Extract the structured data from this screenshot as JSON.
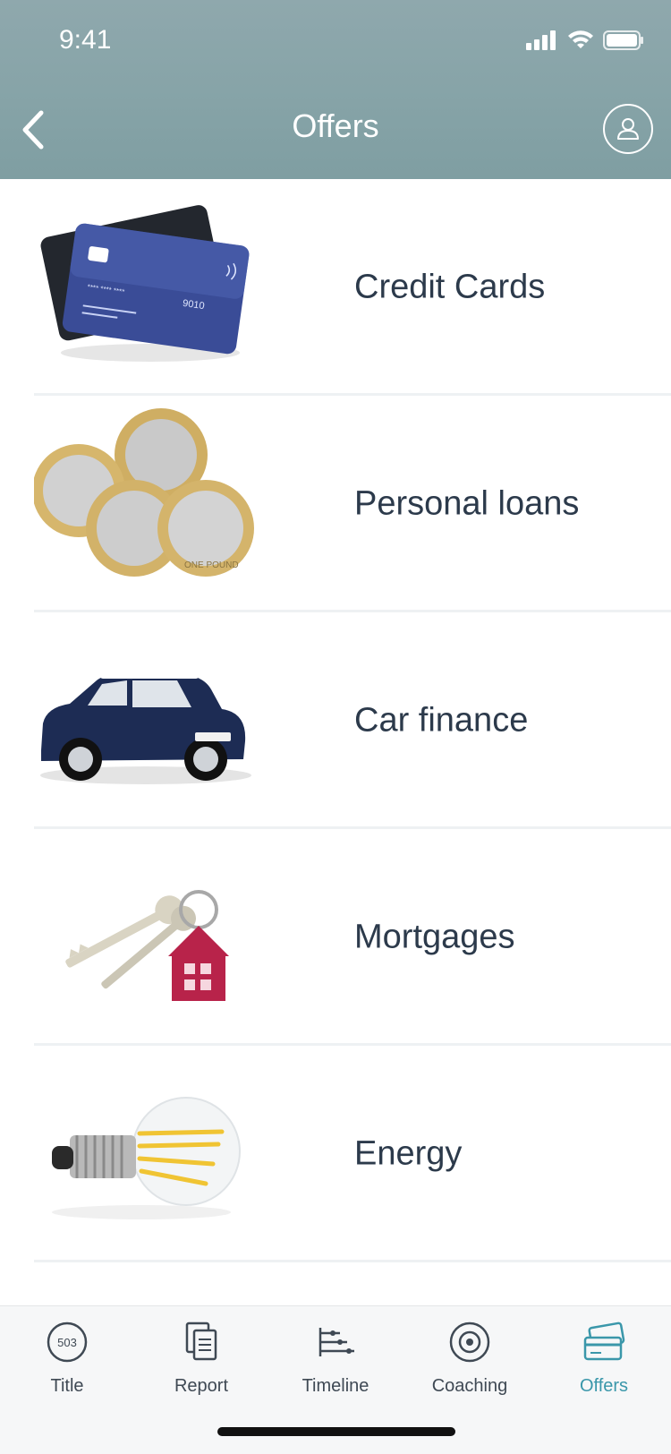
{
  "status_bar": {
    "time": "9:41"
  },
  "header": {
    "title": "Offers",
    "back_icon": "chevron-left-icon",
    "profile_icon": "user-icon"
  },
  "offers": [
    {
      "label": "Credit Cards",
      "image": "credit-cards-image"
    },
    {
      "label": "Personal loans",
      "image": "coins-image"
    },
    {
      "label": "Car finance",
      "image": "car-image"
    },
    {
      "label": "Mortgages",
      "image": "house-keys-image"
    },
    {
      "label": "Energy",
      "image": "light-bulb-image"
    }
  ],
  "tabbar": {
    "active_color": "#3a97aa",
    "items": [
      {
        "label": "Title",
        "icon": "score-dial-icon",
        "badge": "503"
      },
      {
        "label": "Report",
        "icon": "document-icon"
      },
      {
        "label": "Timeline",
        "icon": "timeline-icon"
      },
      {
        "label": "Coaching",
        "icon": "target-icon"
      },
      {
        "label": "Offers",
        "icon": "cards-icon",
        "active": true
      }
    ]
  }
}
